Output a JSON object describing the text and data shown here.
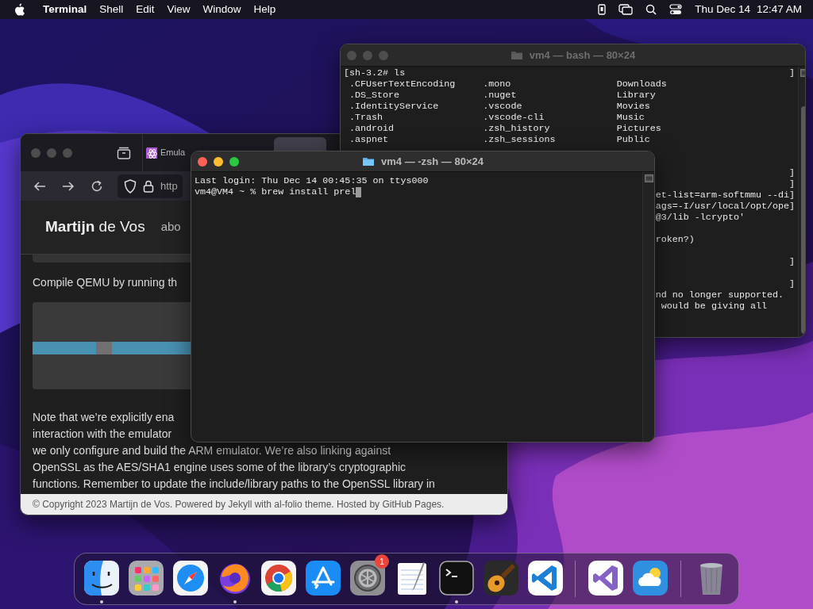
{
  "menu_bar": {
    "app": "Terminal",
    "menus": [
      "Shell",
      "Edit",
      "View",
      "Window",
      "Help"
    ],
    "date": "Thu Dec 14",
    "time": "12:47 AM"
  },
  "browser": {
    "tabs": [
      {
        "kind": "site",
        "label": "Emula",
        "selected": false
      },
      {
        "kind": "strip",
        "selected": true
      }
    ],
    "url": "http",
    "brand": "**Martijn** de Vos",
    "nav_link": "abo",
    "intro": "Compile QEMU by running th",
    "paragraph_lines": [
      "Note that we’re explicitly ena",
      "interaction with the emulator",
      "we only configure and build the ARM emulator. We’re also linking against",
      "OpenSSL as the AES/SHA1 engine uses some of the library’s cryptographic",
      "functions. Remember to update the include/library paths to the OpenSSL library in"
    ],
    "footer": "© Copyright 2023 Martijn de Vos. Powered by Jekyll with al-folio theme. Hosted by GitHub Pages."
  },
  "back_terminal": {
    "title": "vm4 — bash — 80×24",
    "prompt_line": "[sh-3.2# ls",
    "prompt_mark": "]",
    "listing": [
      [
        ".CFUserTextEncoding",
        ".mono",
        "Downloads"
      ],
      [
        ".DS_Store",
        ".nuget",
        "Library"
      ],
      [
        ".IdentityService",
        ".vscode",
        "Movies"
      ],
      [
        ".Trash",
        ".vscode-cli",
        "Music"
      ],
      [
        ".android",
        ".zsh_history",
        "Pictures"
      ],
      [
        ".aspnet",
        ".zsh_sessions",
        "Public"
      ]
    ],
    "tail_lines": [
      {
        "kind": "line",
        "mark": "]"
      },
      {
        "kind": "line",
        "mark": "]"
      },
      {
        "kind": "line",
        "text": "et-list=arm-softmmu --di",
        "mark": "]"
      },
      {
        "kind": "line",
        "text": "ags=-I/usr/local/opt/ope",
        "mark": "]"
      },
      {
        "kind": "line",
        "text": "@3/lib -lcrypto'"
      },
      {
        "kind": "blank"
      },
      {
        "kind": "line",
        "text": "roken?)"
      },
      {
        "kind": "blank"
      },
      {
        "kind": "line",
        "mark": "]"
      },
      {
        "kind": "blank"
      },
      {
        "kind": "line",
        "mark": "]"
      },
      {
        "kind": "line",
        "text": "nd no longer supported."
      },
      {
        "kind": "line",
        "text": " would be giving all"
      }
    ]
  },
  "front_terminal": {
    "title": "vm4 — -zsh — 80×24",
    "lines": [
      "Last login: Thu Dec 14 00:45:35 on ttys000",
      "vm4@VM4 ~ % brew install prel"
    ]
  },
  "dock": [
    {
      "kind": "finder",
      "running": true
    },
    {
      "kind": "launchpad",
      "running": false
    },
    {
      "kind": "safari",
      "running": false
    },
    {
      "kind": "firefox",
      "running": true
    },
    {
      "kind": "chrome",
      "running": false
    },
    {
      "kind": "appstore",
      "running": false
    },
    {
      "kind": "settings",
      "running": false,
      "badge": "1"
    },
    {
      "kind": "textedit",
      "running": false
    },
    {
      "kind": "terminal",
      "running": true
    },
    {
      "kind": "garageband",
      "running": false
    },
    {
      "kind": "vscode",
      "running": false
    },
    {
      "kind": "separator"
    },
    {
      "kind": "visualstudio",
      "running": false
    },
    {
      "kind": "weather",
      "running": false
    },
    {
      "kind": "separator"
    },
    {
      "kind": "trash",
      "running": false
    }
  ]
}
